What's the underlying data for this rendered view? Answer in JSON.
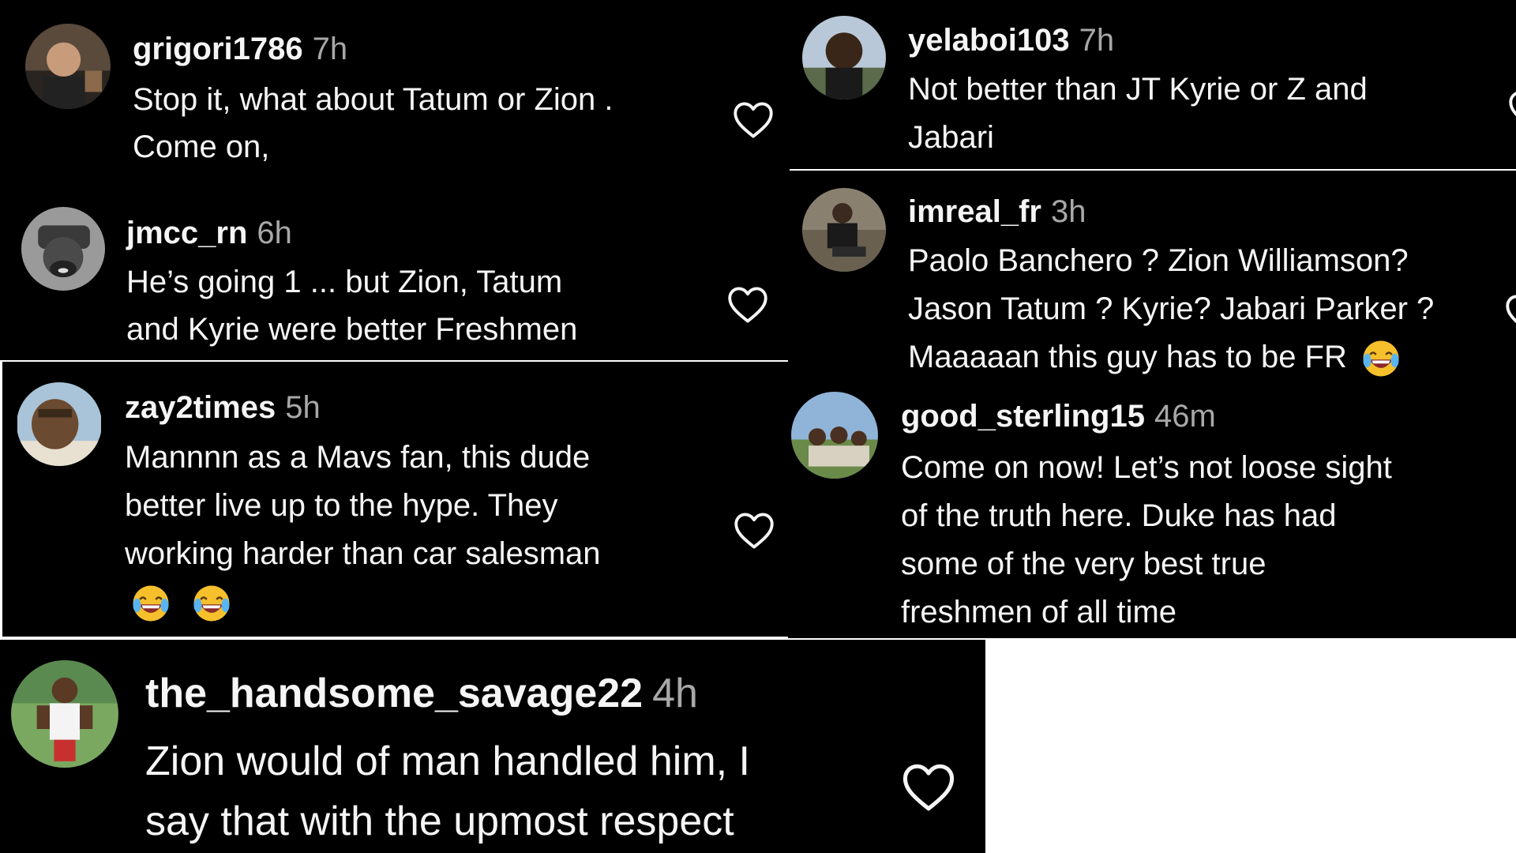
{
  "colors": {
    "background": "#000000",
    "username": "#f5f5f5",
    "timestamp": "#a8a8a8",
    "text": "#f5f5f5",
    "heart_stroke": "#f5f5f5"
  },
  "comments": [
    {
      "username": "grigori1786",
      "time": "7h",
      "lines": [
        "Stop it, what about Tatum or Zion .",
        "Come on,"
      ],
      "like_icon": "heart-outline-icon"
    },
    {
      "username": "jmcc_rn",
      "time": "6h",
      "lines": [
        "He’s going 1 ... but Zion, Tatum",
        "and Kyrie were better Freshmen"
      ],
      "like_icon": "heart-outline-icon"
    },
    {
      "username": "zay2times",
      "time": "5h",
      "lines": [
        "Mannnn as a Mavs fan, this dude",
        "better live up to the hype. They",
        "working harder than car salesman"
      ],
      "emoji_count": 2,
      "emoji_icon": "laughing-crying-emoji",
      "like_icon": "heart-outline-icon"
    },
    {
      "username": "the_handsome_savage22",
      "time": "4h",
      "lines": [
        "Zion would of man handled him, I",
        "say that with the upmost respect"
      ],
      "like_icon": "heart-outline-icon"
    },
    {
      "username": "yelaboi103",
      "time": "7h",
      "lines": [
        "Not better than JT Kyrie or Z and",
        "Jabari"
      ],
      "like_icon": "heart-outline-icon"
    },
    {
      "username": "imreal_fr",
      "time": "3h",
      "lines": [
        "Paolo Banchero ? Zion Williamson?",
        "Jason Tatum ? Kyrie? Jabari Parker ?",
        "Maaaaan this guy has to be FR"
      ],
      "emoji_icon": "laughing-crying-emoji",
      "like_icon": "heart-outline-icon"
    },
    {
      "username": "good_sterling15",
      "time": "46m",
      "lines": [
        "Come on now! Let’s not loose sight",
        "of the truth here. Duke has had",
        "some of the very best true",
        "freshmen of all time"
      ]
    }
  ]
}
